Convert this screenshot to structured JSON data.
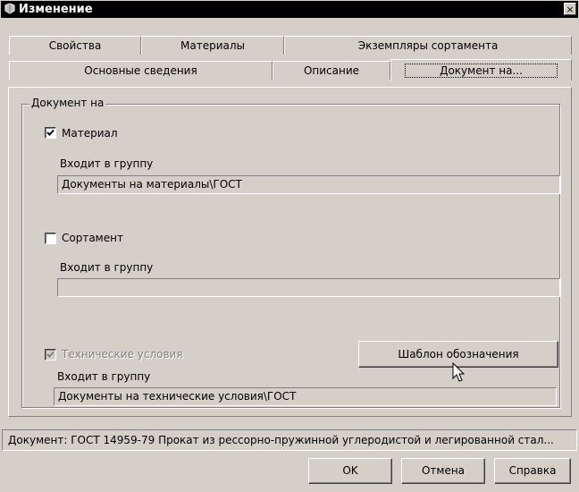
{
  "window": {
    "title": "Изменение",
    "close_glyph": "×"
  },
  "tabs_row1": [
    "Свойства",
    "Материалы",
    "Экземпляры сортамента"
  ],
  "tabs_row2": [
    "Основные сведения",
    "Описание",
    "Документ на..."
  ],
  "active_tab": "Документ на...",
  "group": {
    "legend": "Документ на",
    "material": {
      "label": "Материал",
      "checked": true,
      "group_label": "Входит в группу",
      "group_value": "Документы на материалы\\ГОСТ"
    },
    "sortament": {
      "label": "Сортамент",
      "checked": false,
      "group_label": "Входит в группу",
      "group_value": ""
    },
    "tech": {
      "label": "Технические условия",
      "checked": true,
      "disabled": true,
      "group_label": "Входит в группу",
      "group_value": "Документы на технические условия\\ГОСТ"
    },
    "template_button": "Шаблон обозначения"
  },
  "status": "Документ: ГОСТ 14959-79 Прокат из рессорно-пружинной углеродистой и легированной стал...",
  "buttons": {
    "ok": "OK",
    "cancel": "Отмена",
    "help": "Справка"
  }
}
